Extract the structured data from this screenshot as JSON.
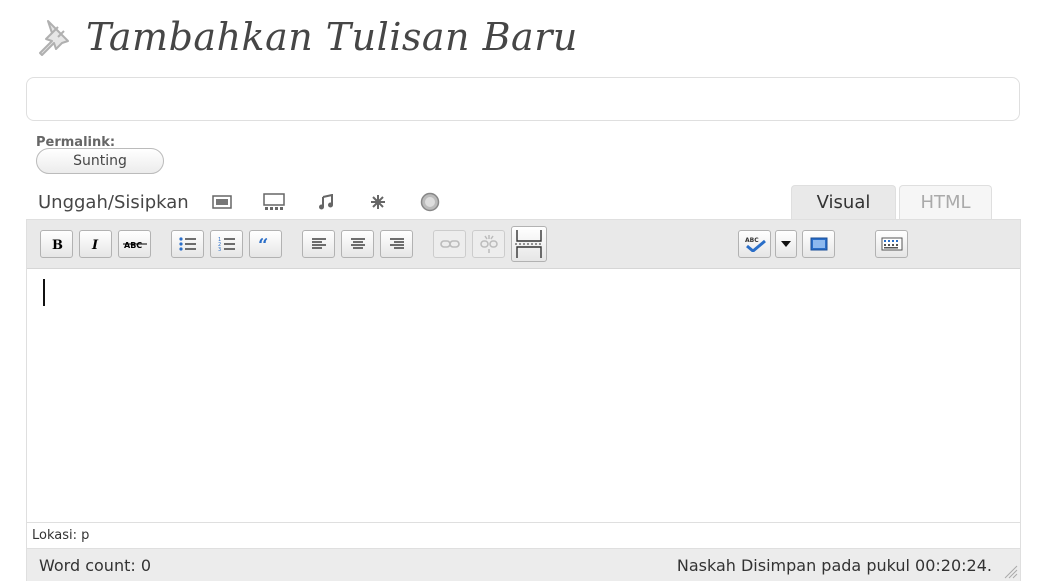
{
  "page": {
    "title": "Tambahkan Tulisan Baru",
    "permalink_label": "Permalink:",
    "edit_button": "Sunting"
  },
  "title_input": {
    "value": "",
    "placeholder": ""
  },
  "media": {
    "label": "Unggah/Sisipkan",
    "icons": [
      "image-icon",
      "gallery-icon",
      "audio-icon",
      "media-icon",
      "video-icon"
    ]
  },
  "tabs": {
    "visual": "Visual",
    "html": "HTML",
    "active": "Visual"
  },
  "toolbar": {
    "buttons": [
      "bold",
      "italic",
      "strikethrough",
      "bulleted-list",
      "numbered-list",
      "blockquote",
      "align-left",
      "align-center",
      "align-right",
      "insert-link",
      "unlink",
      "insert-more",
      "spellcheck",
      "spellcheck-dropdown",
      "fullscreen",
      "kitchen-sink"
    ],
    "disabled": [
      "insert-link",
      "unlink"
    ]
  },
  "editor": {
    "content": "",
    "path": "Lokasi: p"
  },
  "status": {
    "word_count": "Word count: 0",
    "autosave": "Naskah Disimpan pada pukul 00:20:24."
  },
  "colors": {
    "toolbar_bg": "#e9e9e9",
    "border": "#dfdfdf",
    "status_bg": "#ececec"
  }
}
